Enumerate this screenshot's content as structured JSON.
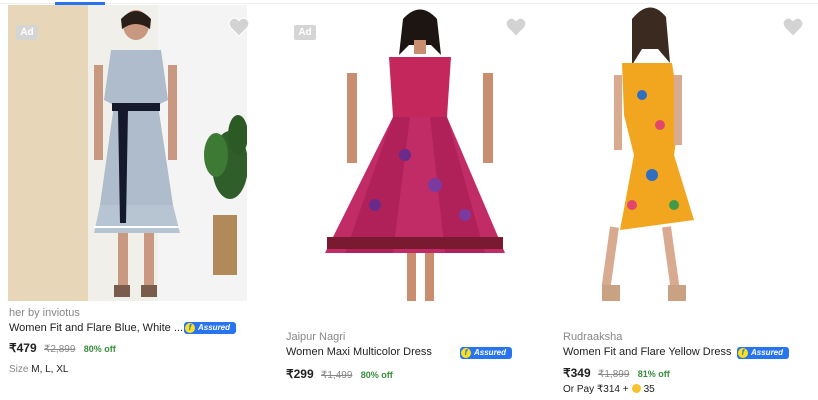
{
  "products": [
    {
      "ad_label": "Ad",
      "brand": "her by inviotus",
      "title": "Women Fit and Flare Blue, White ...",
      "assured": "Assured",
      "price": "₹479",
      "mrp": "₹2,899",
      "discount": "80% off",
      "size_label": "Size",
      "sizes": "M, L, XL"
    },
    {
      "ad_label": "Ad",
      "brand": "Jaipur Nagri",
      "title": "Women Maxi Multicolor Dress",
      "assured": "Assured",
      "price": "₹299",
      "mrp": "₹1,499",
      "discount": "80% off"
    },
    {
      "brand": "Rudraaksha",
      "title": "Women Fit and Flare Yellow Dress",
      "assured": "Assured",
      "price": "₹349",
      "mrp": "₹1,899",
      "discount": "81% off",
      "pay_prefix": "Or Pay ₹314 +",
      "pay_coins": "35"
    }
  ],
  "colors": {
    "accent": "#2874f0",
    "discount": "#388e3c",
    "muted": "#878787",
    "wishlist": "#d3d3d3"
  },
  "icons": [
    "heart-icon",
    "flipkart-assured-icon",
    "supercoin-icon"
  ]
}
